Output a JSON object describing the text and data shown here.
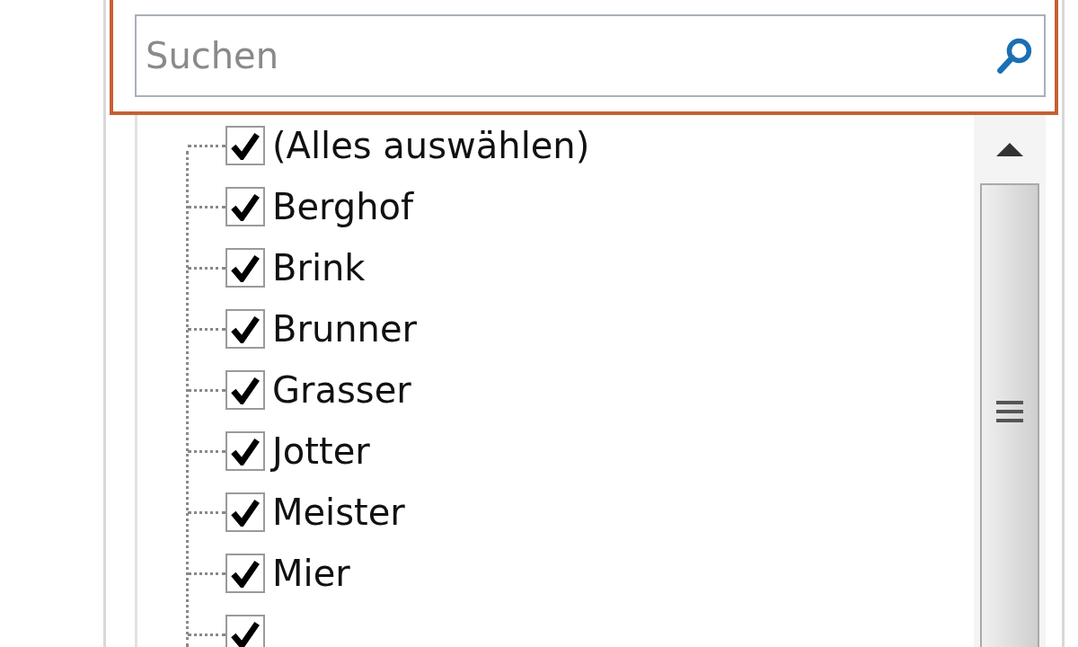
{
  "search": {
    "placeholder": "Suchen",
    "focused": true
  },
  "items": [
    {
      "label": "(Alles auswählen)",
      "checked": true
    },
    {
      "label": "Berghof",
      "checked": true
    },
    {
      "label": "Brink",
      "checked": true
    },
    {
      "label": "Brunner",
      "checked": true
    },
    {
      "label": "Grasser",
      "checked": true
    },
    {
      "label": "Jotter",
      "checked": true
    },
    {
      "label": "Meister",
      "checked": true
    },
    {
      "label": "Mier",
      "checked": true
    },
    {
      "checked": true
    }
  ]
}
